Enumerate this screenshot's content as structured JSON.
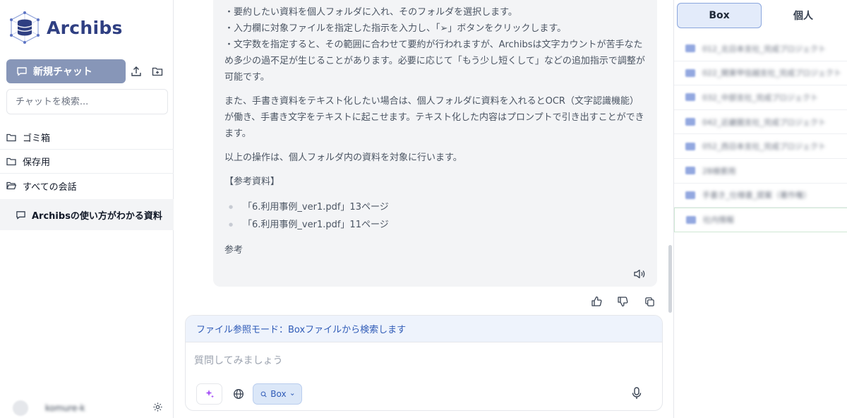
{
  "app": {
    "name": "Archibs",
    "brand_color": "#2f3f82"
  },
  "sidebar": {
    "new_chat_label": "新規チャット",
    "search_placeholder": "チャットを検索...",
    "folders": [
      {
        "label": "ゴミ箱",
        "icon": "folder-icon"
      },
      {
        "label": "保存用",
        "icon": "folder-icon"
      },
      {
        "label": "すべての会話",
        "icon": "folder-open-icon"
      }
    ],
    "conversation": "Archibsの使い方がわかる資料",
    "user_name": "komure-k"
  },
  "message": {
    "lines1": [
      "・要約したい資料を個人フォルダに入れ、そのフォルダを選択します。",
      "・入力欄に対象ファイルを指定した指示を入力し、「➢」ボタンをクリックします。",
      "・文字数を指定すると、その範囲に合わせて要約が行われますが、Archibsは文字カウントが苦手なため多少の過不足が生じることがあります。必要に応じて「もう少し短くして」などの追加指示で調整が可能です。"
    ],
    "para2": "また、手書き資料をテキスト化したい場合は、個人フォルダに資料を入れるとOCR（文字認識機能）が働き、手書き文字をテキストに起こせます。テキスト化した内容はプロンプトで引き出すことができます。",
    "para3": "以上の操作は、個人フォルダ内の資料を対象に行います。",
    "ref_title": "【参考資料】",
    "refs": [
      "「6.利用事例_ver1.pdf」13ページ",
      "「6.利用事例_ver1.pdf」11ページ"
    ],
    "ref_footer": "参考"
  },
  "composer": {
    "mode_text": "ファイル参照モード：Boxファイルから検索します",
    "placeholder": "質問してみましょう",
    "box_label": "Box"
  },
  "right_panel": {
    "tabs": [
      "Box",
      "個人"
    ],
    "active_tab": "Box",
    "folders": [
      "012_北日本支社_完成プロジェクト",
      "022_関東甲信越支社_完成プロジェクト",
      "032_中部支社_完成プロジェクト",
      "042_近畿圏支社_完成プロジェクト",
      "052_西日本支社_完成プロジェクト",
      "2B検索用",
      "手書き_仕様書_提案（著作権）",
      "社内情報"
    ]
  }
}
